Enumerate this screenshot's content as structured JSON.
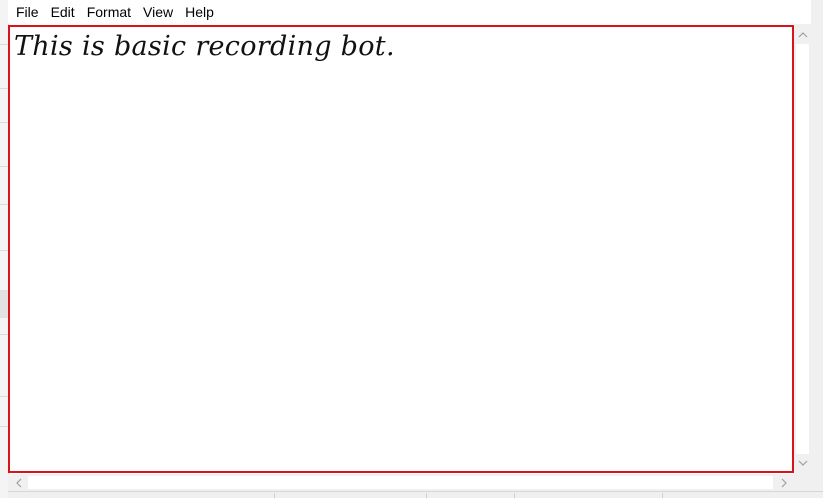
{
  "menu": {
    "file": "File",
    "edit": "Edit",
    "format": "Format",
    "view": "View",
    "help": "Help"
  },
  "editor": {
    "content": "This is basic recording bot."
  },
  "colors": {
    "focus_border": "#d9121b",
    "scrollbar_bg": "#f0f0f0"
  },
  "icons": {
    "scroll_up": "chevron-up-icon",
    "scroll_down": "chevron-down-icon",
    "scroll_left": "chevron-left-icon",
    "scroll_right": "chevron-right-icon"
  }
}
